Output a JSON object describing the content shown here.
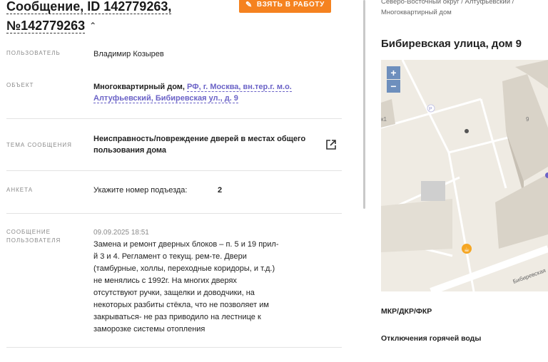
{
  "header": {
    "title_line1": "Сообщение, ID 142779263,",
    "title_line2": "№142779263",
    "chevron": "^",
    "take_button": "ВЗЯТЬ В РАБОТУ"
  },
  "fields": {
    "user": {
      "label": "ПОЛЬЗОВАТЕЛЬ",
      "value": "Владимир Козырев"
    },
    "object": {
      "label": "ОБЪЕКТ",
      "type": "Многоквартирный дом,",
      "link_line1": "РФ, г. Москва, вн.тер.г. м.о.",
      "link_line2": "Алтуфьевский, Бибиревская ул., д. 9"
    },
    "topic": {
      "label": "ТЕМА СООБЩЕНИЯ",
      "line1": "Неисправность/повреждение дверей в местах общего",
      "line2": "пользования дома"
    },
    "survey": {
      "label": "АНКЕТА",
      "question": "Укажите номер подъезда:",
      "answer": "2"
    },
    "message": {
      "label_line1": "СООБЩЕНИЕ",
      "label_line2": "ПОЛЬЗОВАТЕЛЯ",
      "date": "09.09.2025 18:51",
      "text": "Замена и ремонт дверных блоков – п. 5 и 19 прил-й 3 и 4. Регламент о текущ. рем-те. Двери (тамбурные, холлы, переходные коридоры, и т.д.) не менялись с 1992г. На многих дверях отсутствуют ручки, защелки и доводчики, на некоторых разбиты стёкла, что не позволяет им закрываться- не раз приводило на лестнице к заморозке системы отопления"
    }
  },
  "sidebar": {
    "breadcrumb_line1": "Северо-Восточный округ / Алтуфьевский /",
    "breadcrumb_line2": "Многоквартирный дом",
    "address": "Бибиревская улица, дом 9",
    "map": {
      "zoom_in": "+",
      "zoom_out": "−",
      "label_building": "9",
      "label_left": "к1",
      "label_street": "Бибиревская",
      "parking_marker": "P"
    },
    "items": [
      "МКР/ДКР/ФКР",
      "Отключения горячей воды"
    ]
  },
  "colors": {
    "accent": "#f5821f",
    "link": "#6b63c7",
    "map_bg": "#efebe3",
    "zoom": "#6e8fbd"
  }
}
